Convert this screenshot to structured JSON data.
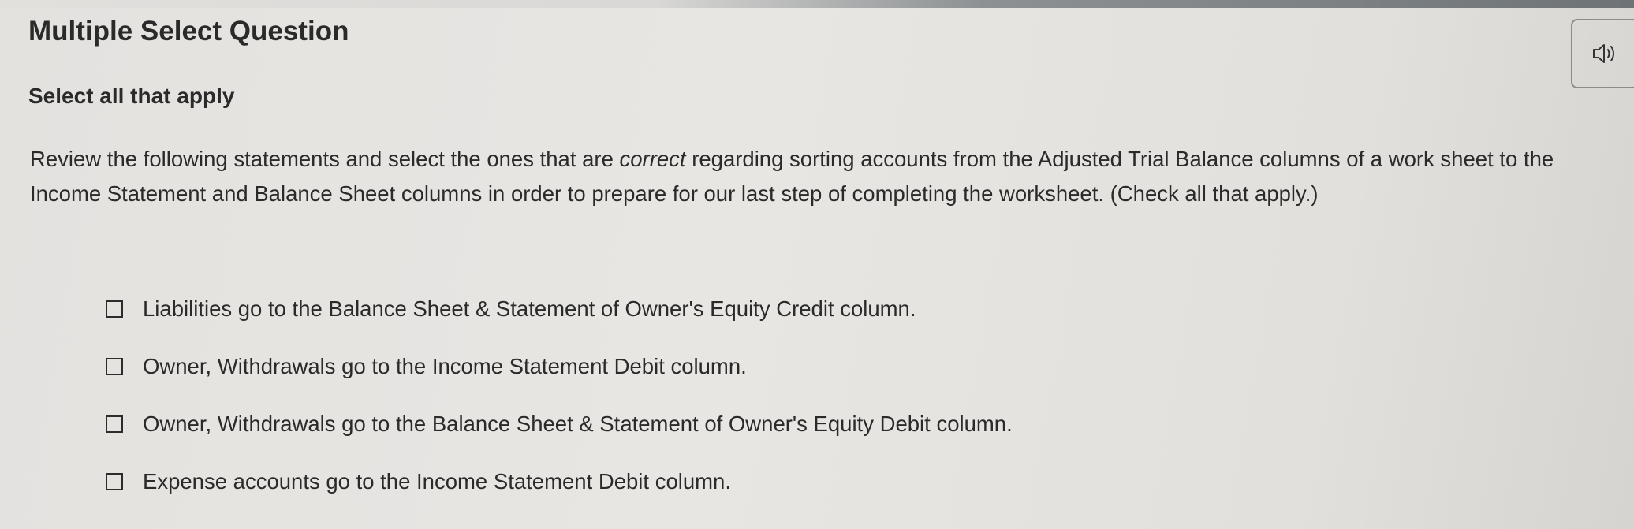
{
  "question": {
    "title": "Multiple Select Question",
    "instruction": "Select all that apply",
    "prompt": {
      "before_emphasis": "Review the following statements and select the ones that are ",
      "emphasis": "correct",
      "after_emphasis": " regarding sorting accounts from the Adjusted Trial Balance columns of a work sheet to the Income Statement and Balance Sheet columns in order to prepare for our last step of completing the worksheet. (Check all that apply.)"
    },
    "audio_button": {
      "icon": "speaker-icon"
    },
    "options": [
      {
        "label": "Liabilities go to the Balance Sheet & Statement of Owner's Equity Credit column.",
        "checked": false
      },
      {
        "label": "Owner, Withdrawals go to the Income Statement Debit column.",
        "checked": false
      },
      {
        "label": "Owner, Withdrawals go to the Balance Sheet & Statement of Owner's Equity Debit column.",
        "checked": false
      },
      {
        "label": "Expense accounts go to the Income Statement Debit column.",
        "checked": false
      }
    ]
  },
  "colors": {
    "background": "#e6e4e1",
    "text": "#2a2a2a",
    "checkbox_border": "#2c2c2c",
    "button_border": "#8c8c8c"
  }
}
